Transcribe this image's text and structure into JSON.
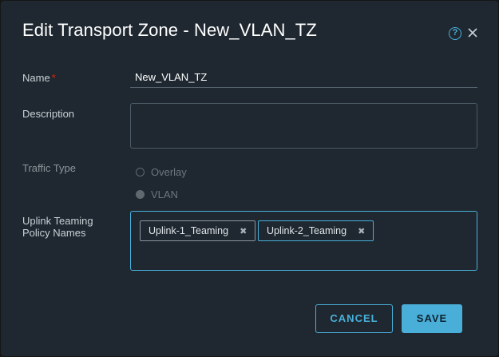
{
  "dialog": {
    "title": "Edit Transport Zone - New_VLAN_TZ",
    "help_icon": "help-circle-icon",
    "close_icon": "close-icon"
  },
  "form": {
    "name": {
      "label": "Name",
      "required_marker": "*",
      "value": "New_VLAN_TZ"
    },
    "description": {
      "label": "Description",
      "value": ""
    },
    "traffic_type": {
      "label": "Traffic Type",
      "options": [
        {
          "label": "Overlay",
          "selected": false
        },
        {
          "label": "VLAN",
          "selected": true
        }
      ],
      "disabled": true
    },
    "uplink_teaming": {
      "label_line1": "Uplink Teaming",
      "label_line2": "Policy Names",
      "chips": [
        {
          "label": "Uplink-1_Teaming",
          "remove": "✖"
        },
        {
          "label": "Uplink-2_Teaming",
          "remove": "✖"
        }
      ]
    }
  },
  "buttons": {
    "cancel": "CANCEL",
    "save": "SAVE"
  },
  "colors": {
    "dialog_bg": "#1f2830",
    "accent": "#49afd9",
    "required": "#e12200"
  }
}
